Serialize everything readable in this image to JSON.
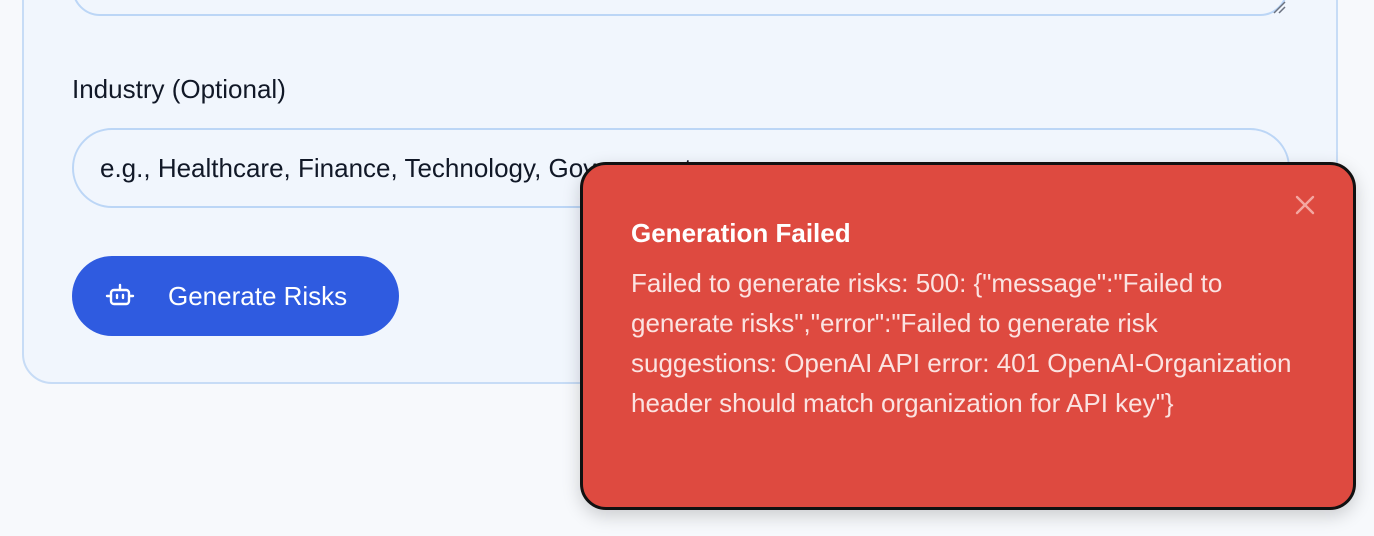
{
  "form": {
    "industry_label": "Industry (Optional)",
    "industry_placeholder": "e.g., Healthcare, Finance, Technology, Government",
    "industry_value": "",
    "generate_button_label": "Generate Risks",
    "generate_button_icon": "bot-icon"
  },
  "toast": {
    "title": "Generation Failed",
    "message": "Failed to generate risks: 500: {\"message\":\"Failed to generate risks\",\"error\":\"Failed to generate risk suggestions: OpenAI API error: 401 OpenAI-Organization header should match organization for API key\"}",
    "close_icon": "close-icon",
    "background_color": "#de4a40"
  },
  "colors": {
    "primary_button": "#2f5be0",
    "card_background": "#f1f6fd",
    "card_border": "#c7dcf6"
  }
}
